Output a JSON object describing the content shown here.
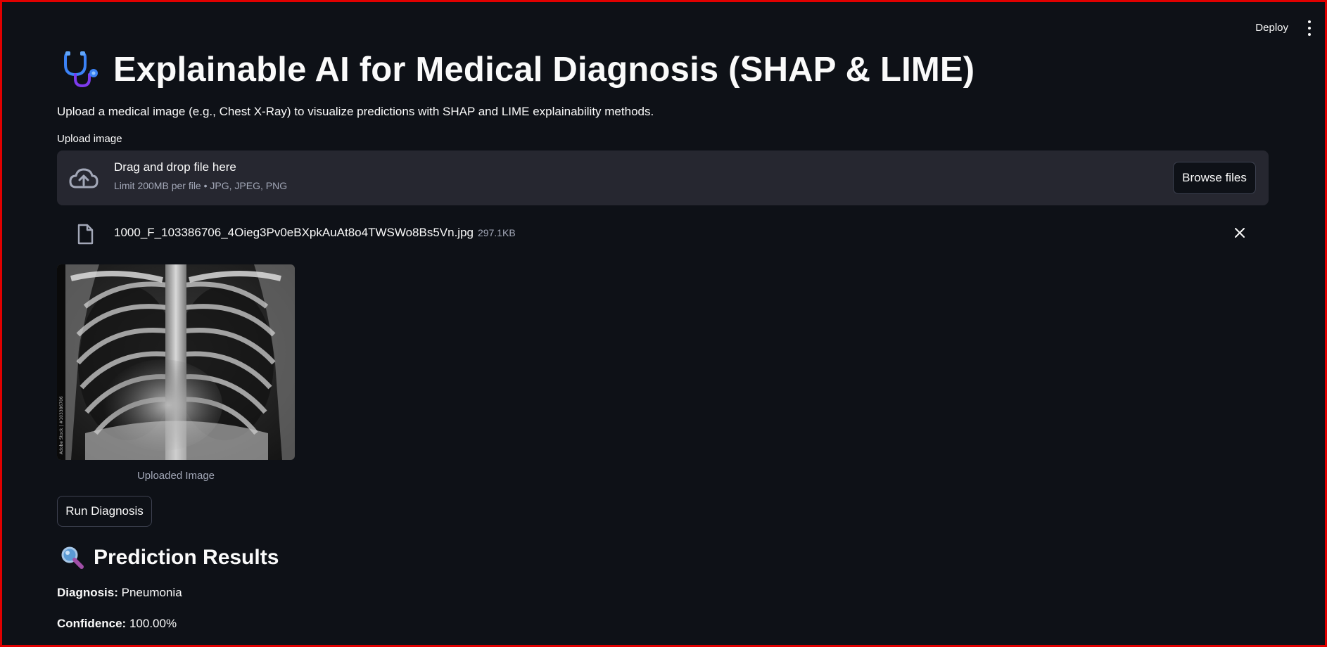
{
  "header": {
    "deploy_label": "Deploy",
    "menu_icon": "kebab-menu-icon"
  },
  "page": {
    "title_icon": "stethoscope-icon",
    "title": "Explainable AI for Medical Diagnosis (SHAP & LIME)",
    "subtitle": "Upload a medical image (e.g., Chest X-Ray) to visualize predictions with SHAP and LIME explainability methods."
  },
  "uploader": {
    "label": "Upload image",
    "drop_text": "Drag and drop file here",
    "limit_text": "Limit 200MB per file • JPG, JPEG, PNG",
    "browse_label": "Browse files",
    "upload_icon": "cloud-upload-icon"
  },
  "uploaded_file": {
    "icon": "file-icon",
    "name": "1000_F_103386706_4Oieg3Pv0eBXpkAuAt8o4TWSWo8Bs5Vn.jpg",
    "size": "297.1KB",
    "remove_icon": "close-icon"
  },
  "image": {
    "caption": "Uploaded Image",
    "watermark": "Adobe Stock | #103386706"
  },
  "actions": {
    "run_label": "Run Diagnosis"
  },
  "results": {
    "icon": "magnifier-icon",
    "title": "Prediction Results",
    "diagnosis_label": "Diagnosis:",
    "diagnosis_value": "Pneumonia",
    "confidence_label": "Confidence:",
    "confidence_value": "100.00%"
  },
  "colors": {
    "background": "#0e1117",
    "dropzone": "#262730",
    "text": "#fafafa",
    "muted": "#a3a8b8",
    "frame_border": "#e00000"
  }
}
